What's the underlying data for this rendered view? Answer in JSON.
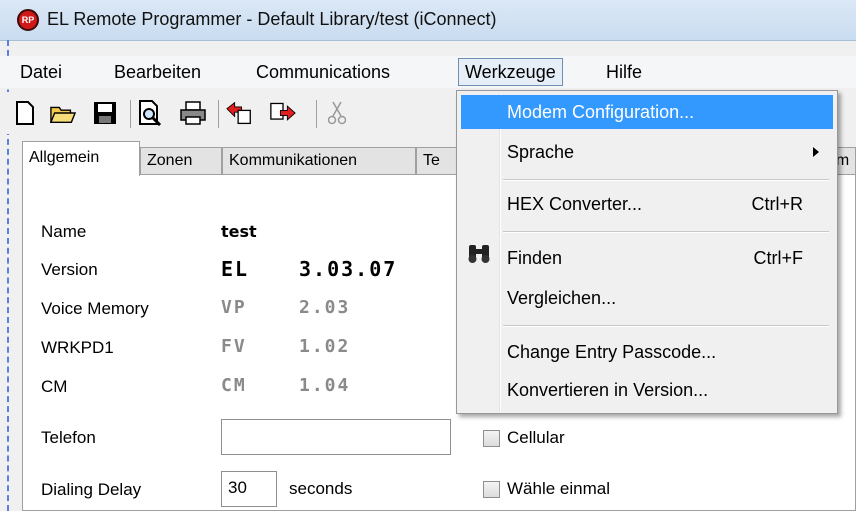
{
  "window": {
    "title": "EL Remote Programmer - Default Library/test (iConnect)",
    "icon_text": "RP"
  },
  "menubar": [
    {
      "label": "Datei"
    },
    {
      "label": "Bearbeiten"
    },
    {
      "label": "Communications"
    },
    {
      "label": "Werkzeuge"
    },
    {
      "label": "Hilfe"
    }
  ],
  "toolbar": {
    "icons": [
      "new-icon",
      "open-icon",
      "save-icon",
      "print-preview-icon",
      "print-icon",
      "upload-icon",
      "download-icon",
      "cut-icon"
    ]
  },
  "tabs": [
    {
      "label": "Allgemein"
    },
    {
      "label": "Zonen"
    },
    {
      "label": "Kommunikationen"
    },
    {
      "label": "Te"
    },
    {
      "label": "om"
    }
  ],
  "general": {
    "name_label": "Name",
    "name_value": "test",
    "version_label": "Version",
    "version_prefix": "EL",
    "version_value": "3.03.07",
    "voice_label": "Voice Memory",
    "voice_prefix": "VP",
    "voice_value": "2.03",
    "wrkpd_label": "WRKPD1",
    "wrkpd_prefix": "FV",
    "wrkpd_value": "1.02",
    "cm_label": "CM",
    "cm_prefix": "CM",
    "cm_value": "1.04",
    "phone_label": "Telefon",
    "phone_value": "",
    "delay_label": "Dialing Delay",
    "delay_value": "30",
    "delay_unit": "seconds",
    "cellular_label": "Cellular",
    "dial_once_label": "Wähle einmal"
  },
  "dropdown": {
    "items": [
      {
        "label": "Modem Configuration...",
        "shortcut": ""
      },
      {
        "label": "Sprache",
        "shortcut": ""
      },
      {
        "label": "HEX Converter...",
        "shortcut": "Ctrl+R"
      },
      {
        "label": "Finden",
        "shortcut": "Ctrl+F"
      },
      {
        "label": "Vergleichen...",
        "shortcut": ""
      },
      {
        "label": "Change Entry Passcode...",
        "shortcut": ""
      },
      {
        "label": "Konvertieren in Version...",
        "shortcut": ""
      }
    ]
  },
  "colors": {
    "highlight": "#3399ff",
    "icon_red": "#d01818"
  }
}
